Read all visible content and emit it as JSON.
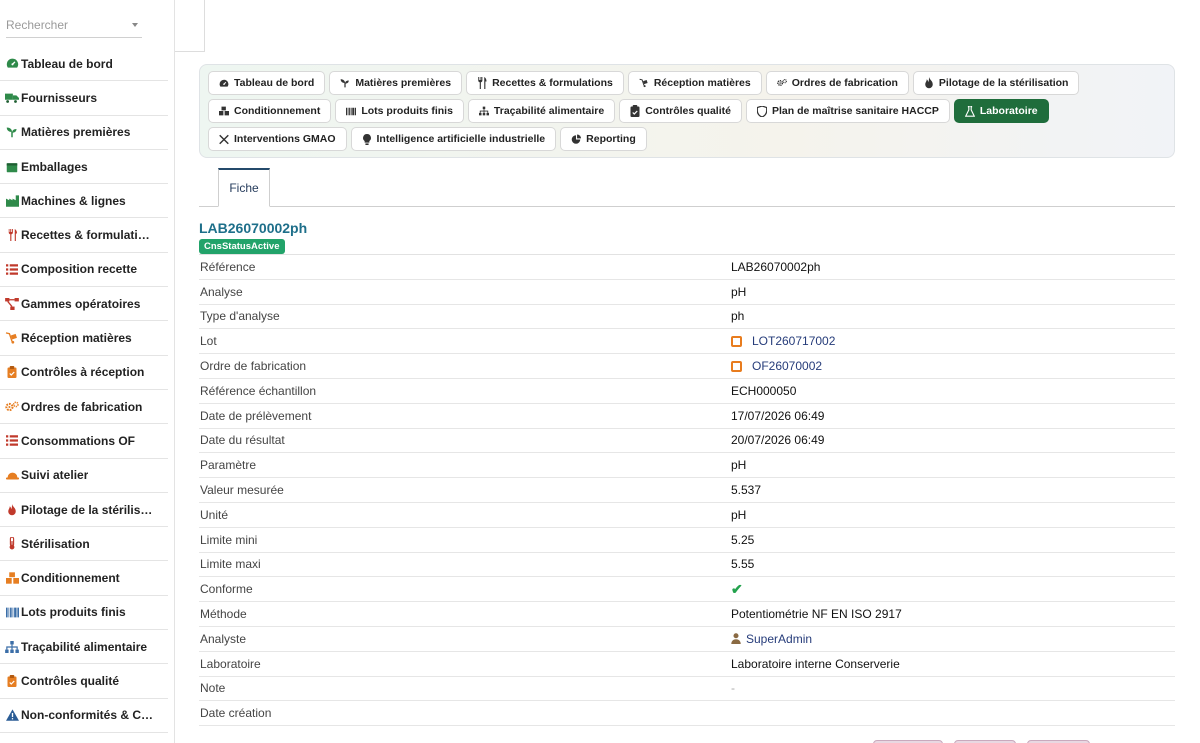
{
  "search": {
    "placeholder": "Rechercher"
  },
  "sidebar": {
    "items": [
      {
        "label": "Tableau de bord",
        "icon": "dashboard-icon"
      },
      {
        "label": "Fournisseurs",
        "icon": "truck-icon"
      },
      {
        "label": "Matières premières",
        "icon": "seedling-icon"
      },
      {
        "label": "Emballages",
        "icon": "box-icon"
      },
      {
        "label": "Machines & lignes",
        "icon": "industry-icon"
      },
      {
        "label": "Recettes & formulati…",
        "icon": "utensils-icon"
      },
      {
        "label": "Composition recette",
        "icon": "list-icon"
      },
      {
        "label": "Gammes opératoires",
        "icon": "project-diagram-icon"
      },
      {
        "label": "Réception matières",
        "icon": "dolly-icon"
      },
      {
        "label": "Contrôles à réception",
        "icon": "clipboard-check-icon"
      },
      {
        "label": "Ordres de fabrication",
        "icon": "cogs-icon"
      },
      {
        "label": "Consommations OF",
        "icon": "list-icon"
      },
      {
        "label": "Suivi atelier",
        "icon": "hard-hat-icon"
      },
      {
        "label": "Pilotage de la stérilis…",
        "icon": "fire-icon"
      },
      {
        "label": "Stérilisation",
        "icon": "thermometer-icon"
      },
      {
        "label": "Conditionnement",
        "icon": "boxes-icon"
      },
      {
        "label": "Lots produits finis",
        "icon": "barcode-icon"
      },
      {
        "label": "Traçabilité alimentaire",
        "icon": "sitemap-icon"
      },
      {
        "label": "Contrôles qualité",
        "icon": "clipboard-check-icon"
      },
      {
        "label": "Non-conformités & C…",
        "icon": "warning-icon"
      }
    ]
  },
  "tabs": [
    {
      "label": "Tableau de bord",
      "icon": "dashboard-icon",
      "active": false
    },
    {
      "label": "Matières premières",
      "icon": "seedling-icon",
      "active": false
    },
    {
      "label": "Recettes & formulations",
      "icon": "utensils-icon",
      "active": false
    },
    {
      "label": "Réception matières",
      "icon": "dolly-icon",
      "active": false
    },
    {
      "label": "Ordres de fabrication",
      "icon": "cogs-icon",
      "active": false
    },
    {
      "label": "Pilotage de la stérilisation",
      "icon": "fire-icon",
      "active": false
    },
    {
      "label": "Conditionnement",
      "icon": "boxes-icon",
      "active": false
    },
    {
      "label": "Lots produits finis",
      "icon": "barcode-icon",
      "active": false
    },
    {
      "label": "Traçabilité alimentaire",
      "icon": "sitemap-icon",
      "active": false
    },
    {
      "label": "Contrôles qualité",
      "icon": "clipboard-check-icon",
      "active": false
    },
    {
      "label": "Plan de maîtrise sanitaire HACCP",
      "icon": "shield-icon",
      "active": false
    },
    {
      "label": "Laboratoire",
      "icon": "flask-icon",
      "active": true
    },
    {
      "label": "Interventions GMAO",
      "icon": "tools-icon",
      "active": false
    },
    {
      "label": "Intelligence artificielle industrielle",
      "icon": "lightbulb-icon",
      "active": false
    },
    {
      "label": "Reporting",
      "icon": "chart-pie-icon",
      "active": false
    }
  ],
  "subtab": {
    "label": "Fiche"
  },
  "record": {
    "title": "LAB26070002ph",
    "status": "CnsStatusActive"
  },
  "fields": [
    {
      "label": "Référence",
      "value": "LAB26070002ph",
      "kind": "text"
    },
    {
      "label": "Analyse",
      "value": "pH",
      "kind": "text"
    },
    {
      "label": "Type d'analyse",
      "value": "ph",
      "kind": "text"
    },
    {
      "label": "Lot",
      "value": "LOT260717002",
      "kind": "link"
    },
    {
      "label": "Ordre de fabrication",
      "value": "OF26070002",
      "kind": "link"
    },
    {
      "label": "Référence échantillon",
      "value": "ECH000050",
      "kind": "text"
    },
    {
      "label": "Date de prélèvement",
      "value": "17/07/2026 06:49",
      "kind": "text"
    },
    {
      "label": "Date du résultat",
      "value": "20/07/2026 06:49",
      "kind": "text"
    },
    {
      "label": "Paramètre",
      "value": "pH",
      "kind": "text"
    },
    {
      "label": "Valeur mesurée",
      "value": "5.537",
      "kind": "text"
    },
    {
      "label": "Unité",
      "value": "pH",
      "kind": "text"
    },
    {
      "label": "Limite mini",
      "value": "5.25",
      "kind": "text"
    },
    {
      "label": "Limite maxi",
      "value": "5.55",
      "kind": "text"
    },
    {
      "label": "Conforme",
      "value": "✔",
      "kind": "check"
    },
    {
      "label": "Méthode",
      "value": "Potentiométrie NF EN ISO 2917",
      "kind": "text"
    },
    {
      "label": "Analyste",
      "value": "SuperAdmin",
      "kind": "user"
    },
    {
      "label": "Laboratoire",
      "value": "Laboratoire interne Conserverie",
      "kind": "text"
    },
    {
      "label": "Note",
      "value": "-",
      "kind": "muted"
    },
    {
      "label": "Date création",
      "value": "",
      "kind": "text"
    }
  ],
  "colors": {
    "active_tab": "#1f6d3c",
    "title": "#1e6f8a",
    "badge": "#22a36a",
    "link": "#263c7a",
    "link_icon": "#e87c1e",
    "check": "#23a24d"
  }
}
